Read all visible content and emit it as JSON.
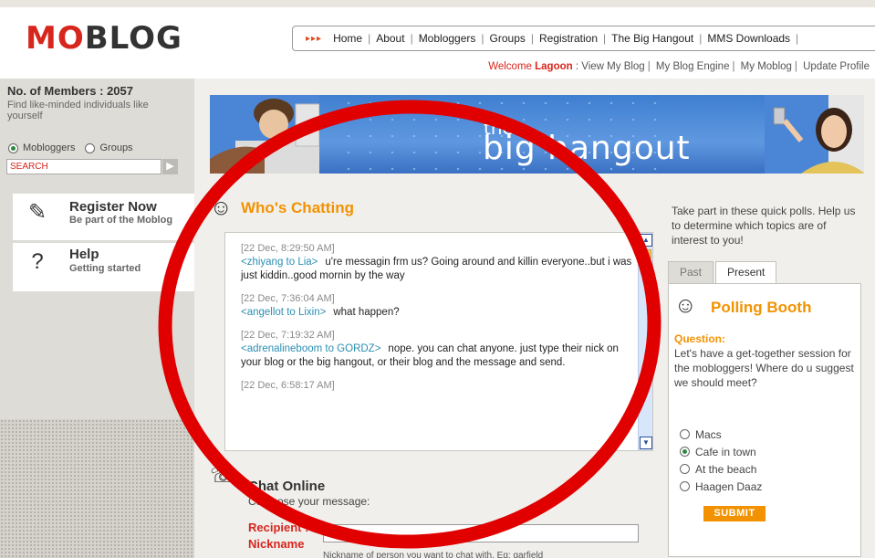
{
  "logo": {
    "mo": "MO",
    "blog": "BLOG"
  },
  "nav": {
    "items": [
      "Home",
      "About",
      "Mobloggers",
      "Groups",
      "Registration",
      "The Big Hangout",
      "MMS Downloads"
    ],
    "arrows": "▸▸▸"
  },
  "welcome": {
    "prefix": "Welcome",
    "user": "Lagoon",
    "links": [
      "View My Blog",
      "My Blog Engine",
      "My Moblog",
      "Update Profile"
    ]
  },
  "sidebar": {
    "members": "No. of Members : 2057",
    "members_sub": "Find like-minded individuals like yourself",
    "radio_mobloggers": "Mobloggers",
    "radio_groups": "Groups",
    "search_placeholder": "SEARCH",
    "register_title": "Register Now",
    "register_sub": "Be part of the Moblog",
    "help_title": "Help",
    "help_sub": "Getting started"
  },
  "banner": {
    "the": "the",
    "big": "big hangout"
  },
  "chat": {
    "title": "Who's Chatting",
    "messages": [
      {
        "ts": "[22 Dec, 8:29:50 AM]",
        "who": "<zhiyang to Lia>",
        "text": "u're messagin frm us? Going around and killin everyone..but i was just kiddin..good mornin by the way"
      },
      {
        "ts": "[22 Dec, 7:36:04 AM]",
        "who": "<angellot to Lixin>",
        "text": "what happen?"
      },
      {
        "ts": "[22 Dec, 7:19:32 AM]",
        "who": "<adrenalineboom to GORDZ>",
        "text": "nope. you can chat anyone. just type their nick on your blog or the big hangout, or their blog and the message and send."
      },
      {
        "ts": "[22 Dec, 6:58:17 AM]",
        "who": "",
        "text": ""
      }
    ]
  },
  "chat_online": {
    "title": "Chat Online",
    "compose": "Compose your message:",
    "recipient_label": "Recipient :",
    "nickname_label": "Nickname",
    "nickname_hint": "Nickname of person you want to chat with. Eg: garfield"
  },
  "polls": {
    "intro": "Take part in these quick polls. Help us to determine which topics are of interest to you!",
    "tab_past": "Past",
    "tab_present": "Present",
    "title": "Polling Booth",
    "question_label": "Question:",
    "question": "Let's have a get-together session for the mobloggers! Where do u suggest we should meet?",
    "options": [
      "Macs",
      "Cafe in town",
      "At the beach",
      "Haagen Daaz"
    ],
    "selected": "Cafe in town",
    "submit": "SUBMIT"
  },
  "colors": {
    "brand_red": "#d7261c",
    "accent_orange": "#f39200",
    "link_teal": "#2b8fb3",
    "annotation_red": "#e00000"
  }
}
